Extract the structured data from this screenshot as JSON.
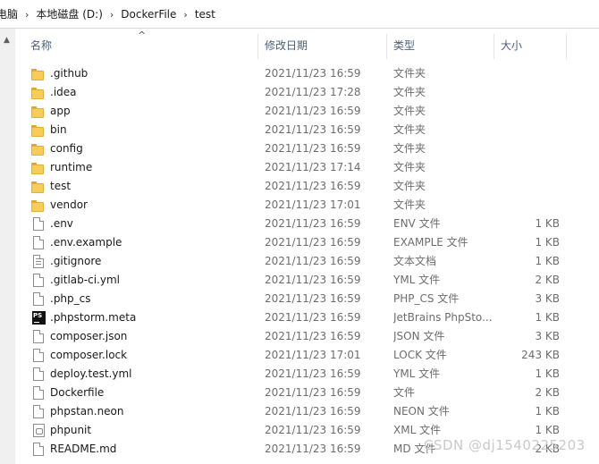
{
  "breadcrumb": [
    "电脑",
    "本地磁盘 (D:)",
    "DockerFile",
    "test"
  ],
  "header": {
    "name": "名称",
    "date": "修改日期",
    "type": "类型",
    "size": "大小"
  },
  "watermark": "CSDN @dj1540225203",
  "files": [
    {
      "name": ".github",
      "date": "2021/11/23 16:59",
      "type": "文件夹",
      "size": "",
      "icon": "folder-icon"
    },
    {
      "name": ".idea",
      "date": "2021/11/23 17:28",
      "type": "文件夹",
      "size": "",
      "icon": "folder-icon"
    },
    {
      "name": "app",
      "date": "2021/11/23 16:59",
      "type": "文件夹",
      "size": "",
      "icon": "folder-icon"
    },
    {
      "name": "bin",
      "date": "2021/11/23 16:59",
      "type": "文件夹",
      "size": "",
      "icon": "folder-icon"
    },
    {
      "name": "config",
      "date": "2021/11/23 16:59",
      "type": "文件夹",
      "size": "",
      "icon": "folder-icon"
    },
    {
      "name": "runtime",
      "date": "2021/11/23 17:14",
      "type": "文件夹",
      "size": "",
      "icon": "folder-icon"
    },
    {
      "name": "test",
      "date": "2021/11/23 16:59",
      "type": "文件夹",
      "size": "",
      "icon": "folder-icon"
    },
    {
      "name": "vendor",
      "date": "2021/11/23 17:01",
      "type": "文件夹",
      "size": "",
      "icon": "folder-icon"
    },
    {
      "name": ".env",
      "date": "2021/11/23 16:59",
      "type": "ENV 文件",
      "size": "1 KB",
      "icon": "file-icon"
    },
    {
      "name": ".env.example",
      "date": "2021/11/23 16:59",
      "type": "EXAMPLE 文件",
      "size": "1 KB",
      "icon": "file-icon"
    },
    {
      "name": ".gitignore",
      "date": "2021/11/23 16:59",
      "type": "文本文档",
      "size": "1 KB",
      "icon": "text-file-icon"
    },
    {
      "name": ".gitlab-ci.yml",
      "date": "2021/11/23 16:59",
      "type": "YML 文件",
      "size": "2 KB",
      "icon": "file-icon"
    },
    {
      "name": ".php_cs",
      "date": "2021/11/23 16:59",
      "type": "PHP_CS 文件",
      "size": "3 KB",
      "icon": "file-icon"
    },
    {
      "name": ".phpstorm.meta",
      "date": "2021/11/23 16:59",
      "type": "JetBrains PhpSto...",
      "size": "1 KB",
      "icon": "phpstorm-icon"
    },
    {
      "name": "composer.json",
      "date": "2021/11/23 16:59",
      "type": "JSON 文件",
      "size": "3 KB",
      "icon": "file-icon"
    },
    {
      "name": "composer.lock",
      "date": "2021/11/23 17:01",
      "type": "LOCK 文件",
      "size": "243 KB",
      "icon": "file-icon"
    },
    {
      "name": "deploy.test.yml",
      "date": "2021/11/23 16:59",
      "type": "YML 文件",
      "size": "1 KB",
      "icon": "file-icon"
    },
    {
      "name": "Dockerfile",
      "date": "2021/11/23 16:59",
      "type": "文件",
      "size": "2 KB",
      "icon": "file-icon"
    },
    {
      "name": "phpstan.neon",
      "date": "2021/11/23 16:59",
      "type": "NEON 文件",
      "size": "1 KB",
      "icon": "file-icon"
    },
    {
      "name": "phpunit",
      "date": "2021/11/23 16:59",
      "type": "XML 文件",
      "size": "1 KB",
      "icon": "xml-file-icon"
    },
    {
      "name": "README.md",
      "date": "2021/11/23 16:59",
      "type": "MD 文件",
      "size": "2 KB",
      "icon": "file-icon"
    }
  ]
}
